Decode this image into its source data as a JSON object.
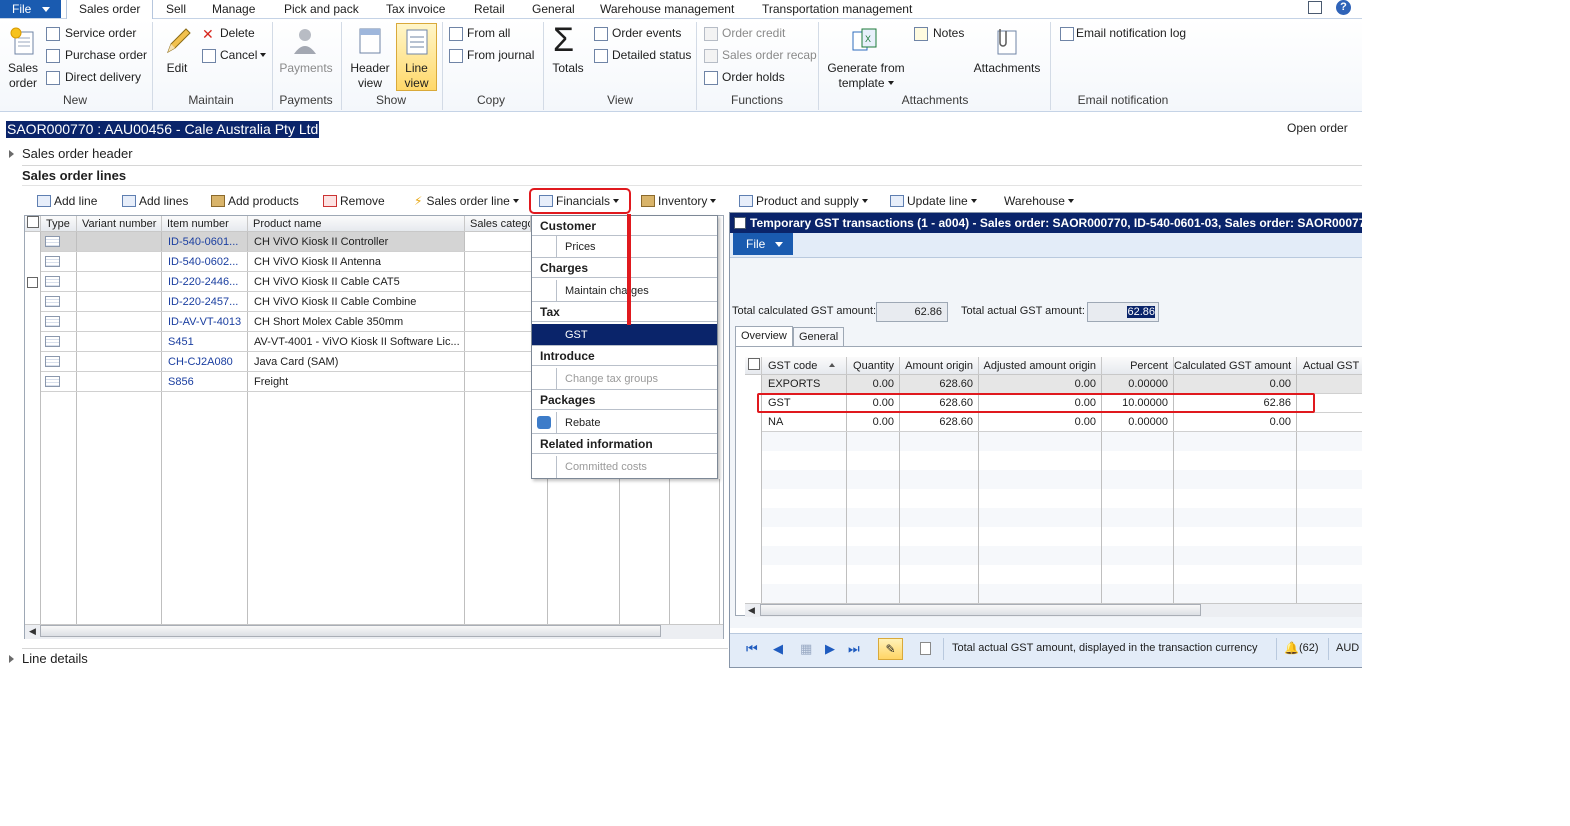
{
  "ribbon_tabs": {
    "file": "File",
    "tabs": [
      "Sales order",
      "Sell",
      "Manage",
      "Pick and pack",
      "Tax invoice",
      "Retail",
      "General",
      "Warehouse management",
      "Transportation management"
    ]
  },
  "ribbon": {
    "new": {
      "group": "New",
      "sales_order_1": "Sales",
      "sales_order_2": "order",
      "service_order": "Service order",
      "purchase_order": "Purchase order",
      "direct_delivery": "Direct delivery"
    },
    "maintain": {
      "group": "Maintain",
      "edit": "Edit",
      "delete": "Delete",
      "cancel": "Cancel"
    },
    "payments": {
      "group": "Payments",
      "payments": "Payments"
    },
    "show": {
      "group": "Show",
      "header_view_1": "Header",
      "header_view_2": "view",
      "line_view_1": "Line",
      "line_view_2": "view"
    },
    "copy": {
      "group": "Copy",
      "from_all": "From all",
      "from_journal": "From journal"
    },
    "view": {
      "group": "View",
      "totals": "Totals",
      "order_events": "Order events",
      "detailed_status": "Detailed status"
    },
    "functions": {
      "group": "Functions",
      "order_credit": "Order credit",
      "sales_order_recap": "Sales order recap",
      "order_holds": "Order holds"
    },
    "attachments": {
      "group": "Attachments",
      "generate_1": "Generate from",
      "generate_2": "template",
      "notes": "Notes",
      "attachments": "Attachments"
    },
    "email": {
      "group": "Email notification",
      "log": "Email notification log"
    }
  },
  "record": {
    "title": "SAOR000770 : AAU00456 - Cale Australia Pty Ltd",
    "status": "Open order"
  },
  "fasttabs": {
    "header": "Sales order header",
    "lines": "Sales order lines",
    "details": "Line details"
  },
  "lines_toolbar": {
    "add_line": "Add line",
    "add_lines": "Add lines",
    "add_products": "Add products",
    "remove": "Remove",
    "sales_order_line": "Sales order line",
    "financials": "Financials",
    "inventory": "Inventory",
    "product_and_supply": "Product and supply",
    "update_line": "Update line",
    "warehouse": "Warehouse"
  },
  "lines_grid": {
    "columns": [
      "Type",
      "Variant number",
      "Item number",
      "Product name",
      "Sales catego"
    ],
    "rows": [
      {
        "item": "ID-540-0601...",
        "name": "CH ViVO Kiosk II Controller"
      },
      {
        "item": "ID-540-0602...",
        "name": "CH ViVO Kiosk II Antenna"
      },
      {
        "item": "ID-220-2446...",
        "name": "CH ViVO Kiosk II Cable CAT5"
      },
      {
        "item": "ID-220-2457...",
        "name": "CH ViVO Kiosk II Cable Combine"
      },
      {
        "item": "ID-AV-VT-4013",
        "name": "CH Short Molex Cable 350mm"
      },
      {
        "item": "S451",
        "name": "AV-VT-4001 - ViVO Kiosk II Software Lic..."
      },
      {
        "item": "CH-CJ2A080",
        "name": "Java Card (SAM)"
      },
      {
        "item": "S856",
        "name": "Freight"
      }
    ]
  },
  "financials_menu": {
    "customer": "Customer",
    "prices": "Prices",
    "charges": "Charges",
    "maintain_charges": "Maintain charges",
    "tax": "Tax",
    "gst": "GST",
    "introduce": "Introduce",
    "change_tax_groups": "Change tax groups",
    "packages": "Packages",
    "rebate": "Rebate",
    "related": "Related information",
    "committed_costs": "Committed costs"
  },
  "gst_window": {
    "title": "Temporary GST transactions (1 - a004) - Sales order: SAOR000770, ID-540-0601-03, Sales order: SAOR00077",
    "file": "File",
    "total_calc_label": "Total calculated GST amount:",
    "total_calc_value": "62.86",
    "total_actual_label": "Total actual GST amount:",
    "total_actual_value": "62.86",
    "tabs": [
      "Overview",
      "General"
    ],
    "columns": [
      "GST code",
      "Quantity",
      "Amount origin",
      "Adjusted amount origin",
      "Percent",
      "Calculated GST amount",
      "Actual GST a"
    ],
    "rows": [
      {
        "code": "EXPORTS",
        "quantity": "0.00",
        "amount_origin": "628.60",
        "adjusted": "0.00",
        "percent": "0.00000",
        "calculated": "0.00"
      },
      {
        "code": "GST",
        "quantity": "0.00",
        "amount_origin": "628.60",
        "adjusted": "0.00",
        "percent": "10.00000",
        "calculated": "62.86"
      },
      {
        "code": "NA",
        "quantity": "0.00",
        "amount_origin": "628.60",
        "adjusted": "0.00",
        "percent": "0.00000",
        "calculated": "0.00"
      }
    ],
    "statusbar": {
      "help_text": "Total actual GST amount, displayed in the transaction currency",
      "notifications": "(62)",
      "currency": "AUD"
    }
  },
  "colors": {
    "brand_blue": "#1a5bb0",
    "selection_navy": "#0a246a",
    "annotation_red": "#e0191e",
    "link_blue": "#1a3ea0"
  }
}
